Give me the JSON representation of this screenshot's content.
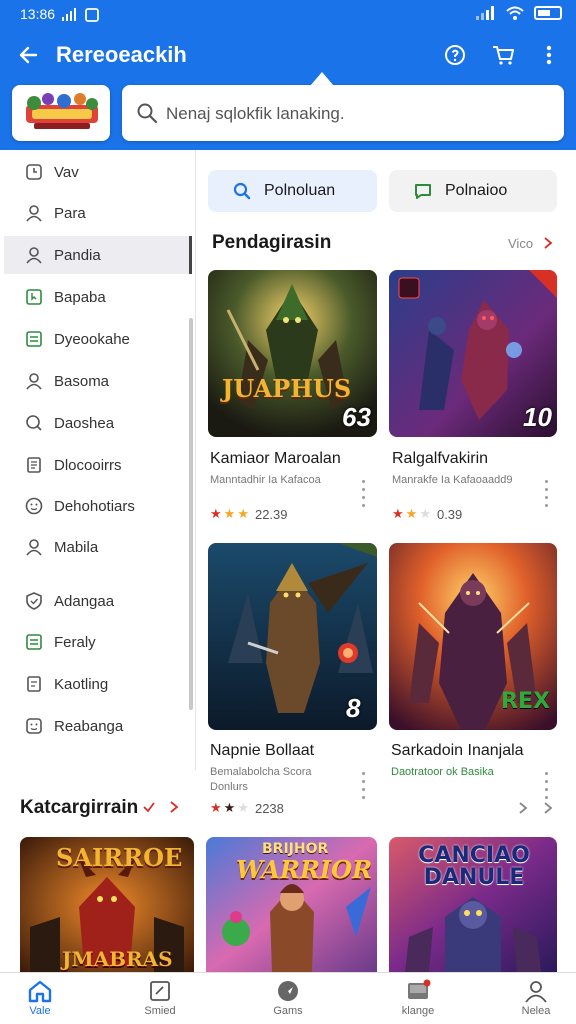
{
  "status": {
    "time": "13:86"
  },
  "appbar": {
    "title": "Rereoeackih"
  },
  "search": {
    "placeholder": "Nenaj sqlokfik lanaking."
  },
  "sidebar": {
    "items": [
      {
        "label": "Vav",
        "icon": "clock-icon"
      },
      {
        "label": "Para",
        "icon": "person-icon"
      },
      {
        "label": "Pandia",
        "icon": "person-icon",
        "active": true
      },
      {
        "label": "Bapaba",
        "icon": "bookmark-icon"
      },
      {
        "label": "Dyeookahe",
        "icon": "list-icon"
      },
      {
        "label": "Basoma",
        "icon": "person-icon"
      },
      {
        "label": "Daoshea",
        "icon": "search-icon"
      },
      {
        "label": "Dlocooirrs",
        "icon": "doc-icon"
      },
      {
        "label": "Dehohotiars",
        "icon": "face-icon"
      },
      {
        "label": "Mabila",
        "icon": "person-icon"
      },
      {
        "label": "Adangaa",
        "icon": "shield-icon"
      },
      {
        "label": "Feraly",
        "icon": "list-icon"
      },
      {
        "label": "Kaotling",
        "icon": "doc-icon"
      },
      {
        "label": "Reabanga",
        "icon": "face-icon"
      }
    ]
  },
  "tabs": [
    {
      "label": "Polnoluan",
      "icon": "search-icon"
    },
    {
      "label": "Polnaioo",
      "icon": "chat-icon"
    }
  ],
  "section1": {
    "title": "Pendagirasin",
    "see_all": "Vico",
    "cards": [
      {
        "name": "Kamiaor Maroalan",
        "sub": "Manntadhir Ia Kafacoa",
        "sub2": "",
        "rating": "22.39",
        "badge": "63",
        "art_title": "JUAPHUS"
      },
      {
        "name": "Ralgalfvakirin",
        "sub": "Manrakfe Ia Kafaoaadd9",
        "sub2": "",
        "rating": "0.39",
        "badge": "10",
        "art_title": ""
      },
      {
        "name": "Napnie Bollaat",
        "sub": "Bemalabolcha Scora",
        "sub2": "Donlurs",
        "rating": "2238",
        "badge": "8",
        "art_title": ""
      },
      {
        "name": "Sarkadoin Inanjala",
        "sub": "Daotratoor ok Basika",
        "sub2": "",
        "rating": "",
        "badge": "",
        "art_title": "REX"
      }
    ]
  },
  "section2": {
    "title": "Katcargirrain",
    "cards": [
      {
        "art_title": "SAIRROE",
        "art_sub": "JMABRAS"
      },
      {
        "art_title": "WARRIOR",
        "art_sub": "BRIJHOR"
      },
      {
        "art_title": "CANCIAO DANULE",
        "art_sub": ""
      }
    ]
  },
  "bottom_nav": [
    {
      "label": "Vale",
      "icon": "home-icon",
      "active": true
    },
    {
      "label": "Smied",
      "icon": "edit-icon"
    },
    {
      "label": "Gams",
      "icon": "compass-icon"
    },
    {
      "label": "klange",
      "icon": "inbox-icon"
    },
    {
      "label": "Nelea",
      "icon": "profile-icon"
    }
  ],
  "colors": {
    "primary": "#1a73e8",
    "accent_red": "#d93025",
    "star": "#f5a623"
  }
}
